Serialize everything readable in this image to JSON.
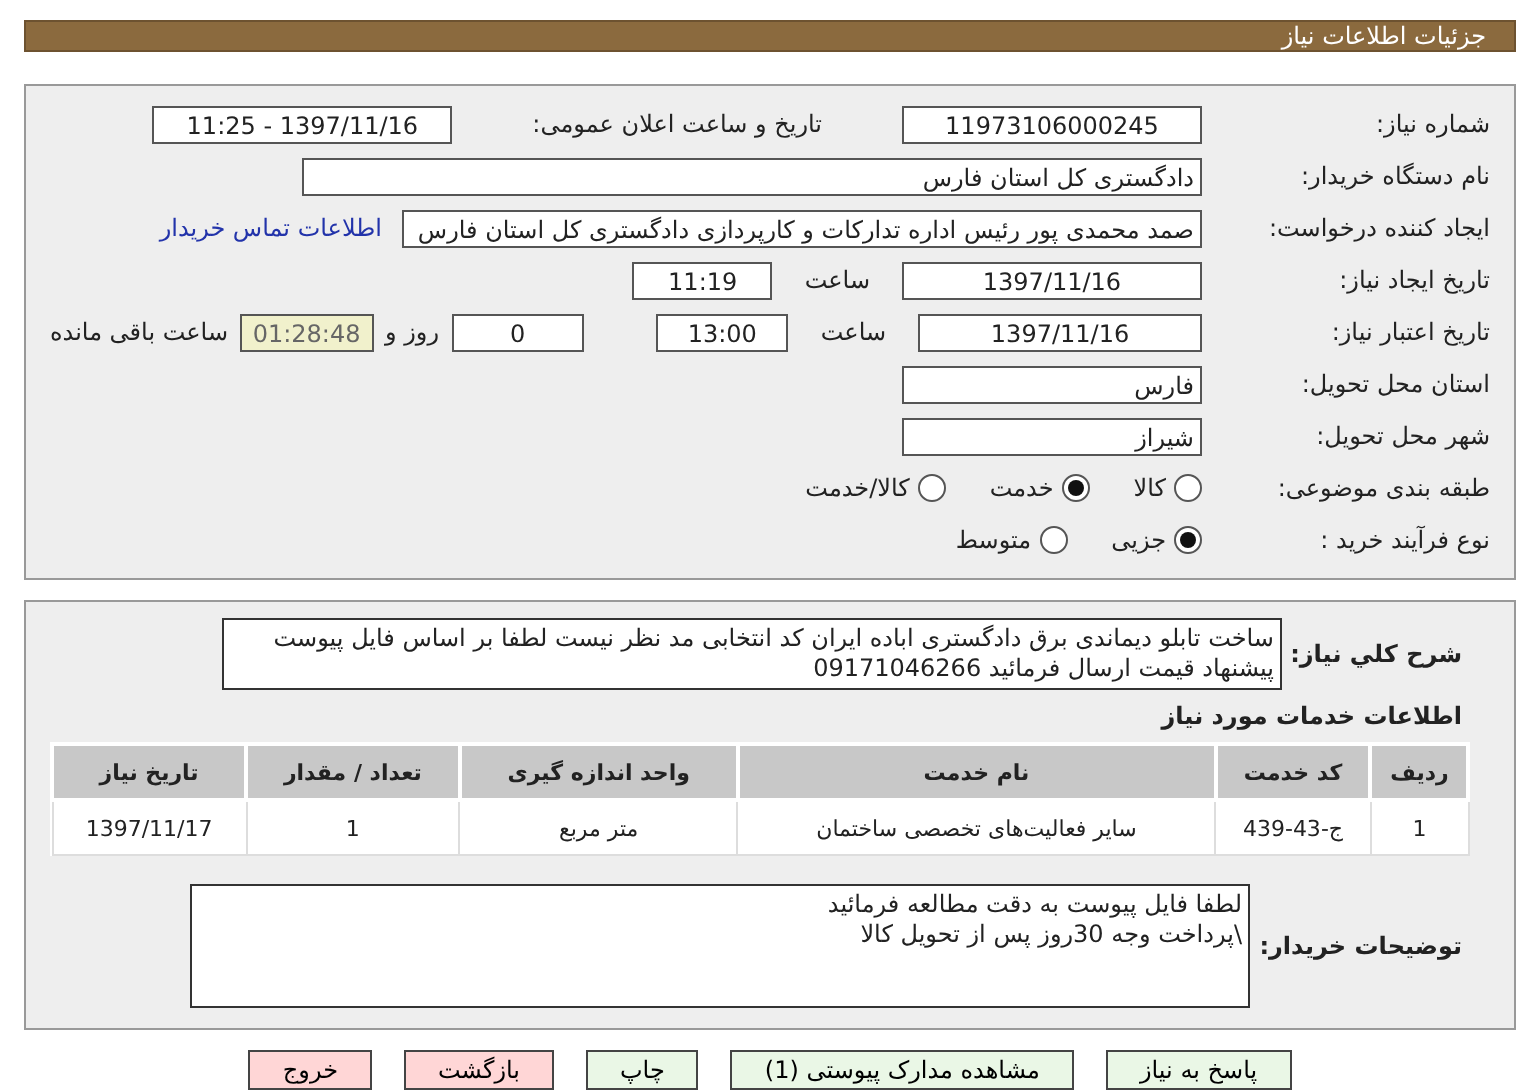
{
  "header": {
    "title": "جزئیات اطلاعات نیاز"
  },
  "need_number": {
    "label": "شماره نیاز:",
    "value": "11973106000245"
  },
  "announce": {
    "label": "تاریخ و ساعت اعلان عمومی:",
    "value": "1397/11/16 - 11:25"
  },
  "buyer": {
    "label": "نام دستگاه خریدار:",
    "value": "دادگستری کل استان فارس"
  },
  "requester": {
    "label": "ایجاد کننده درخواست:",
    "value": "صمد محمدی پور رئیس اداره تدارکات و کارپردازی دادگستری کل استان فارس",
    "link": "اطلاعات تماس خریدار"
  },
  "created": {
    "label": "تاریخ ایجاد نیاز:",
    "date": "1397/11/16",
    "time_label": "ساعت",
    "time": "11:19"
  },
  "validity": {
    "label": "تاریخ اعتبار نیاز:",
    "date": "1397/11/16",
    "time_label": "ساعت",
    "time": "13:00",
    "days": "0",
    "days_label": "روز و",
    "remaining": "01:28:48",
    "remaining_label": "ساعت باقی مانده"
  },
  "province": {
    "label": "استان محل تحویل:",
    "value": "فارس"
  },
  "city": {
    "label": "شهر محل تحویل:",
    "value": "شیراز"
  },
  "category": {
    "label": "طبقه بندی موضوعی:",
    "options": [
      {
        "label": "کالا",
        "selected": false
      },
      {
        "label": "خدمت",
        "selected": true
      },
      {
        "label": "کالا/خدمت",
        "selected": false
      }
    ]
  },
  "process": {
    "label": "نوع فرآیند خرید :",
    "options": [
      {
        "label": "جزیی",
        "selected": true
      },
      {
        "label": "متوسط",
        "selected": false
      }
    ]
  },
  "description": {
    "label": "شرح کلي نياز:",
    "lines": [
      "ساخت تابلو دیماندی برق دادگستری اباده ایران کد انتخابی مد نظر نیست لطفا بر اساس فایل پیوست",
      "پیشنهاد قیمت ارسال فرمائید 09171046266"
    ]
  },
  "services": {
    "title": "اطلاعات خدمات مورد نیاز",
    "columns": [
      "ردیف",
      "کد خدمت",
      "نام خدمت",
      "واحد اندازه گیری",
      "تعداد / مقدار",
      "تاریخ نیاز"
    ],
    "rows": [
      [
        "1",
        "ج-43-439",
        "سایر فعالیت‌های تخصصی ساختمان",
        "متر مربع",
        "1",
        "1397/11/17"
      ]
    ]
  },
  "buyer_notes": {
    "label": "توضیحات خریدار:",
    "lines": [
      "لطفا فایل پیوست به دقت مطالعه فرمائید",
      "\\پرداخت وجه 30روز پس از تحویل کالا"
    ]
  },
  "buttons": [
    {
      "label": "پاسخ به نیاز",
      "kind": "action"
    },
    {
      "label": "مشاهده مدارک پیوستی (1)",
      "kind": "action"
    },
    {
      "label": "چاپ",
      "kind": "action"
    },
    {
      "label": "بازگشت",
      "kind": "exit"
    },
    {
      "label": "خروج",
      "kind": "exit"
    }
  ]
}
